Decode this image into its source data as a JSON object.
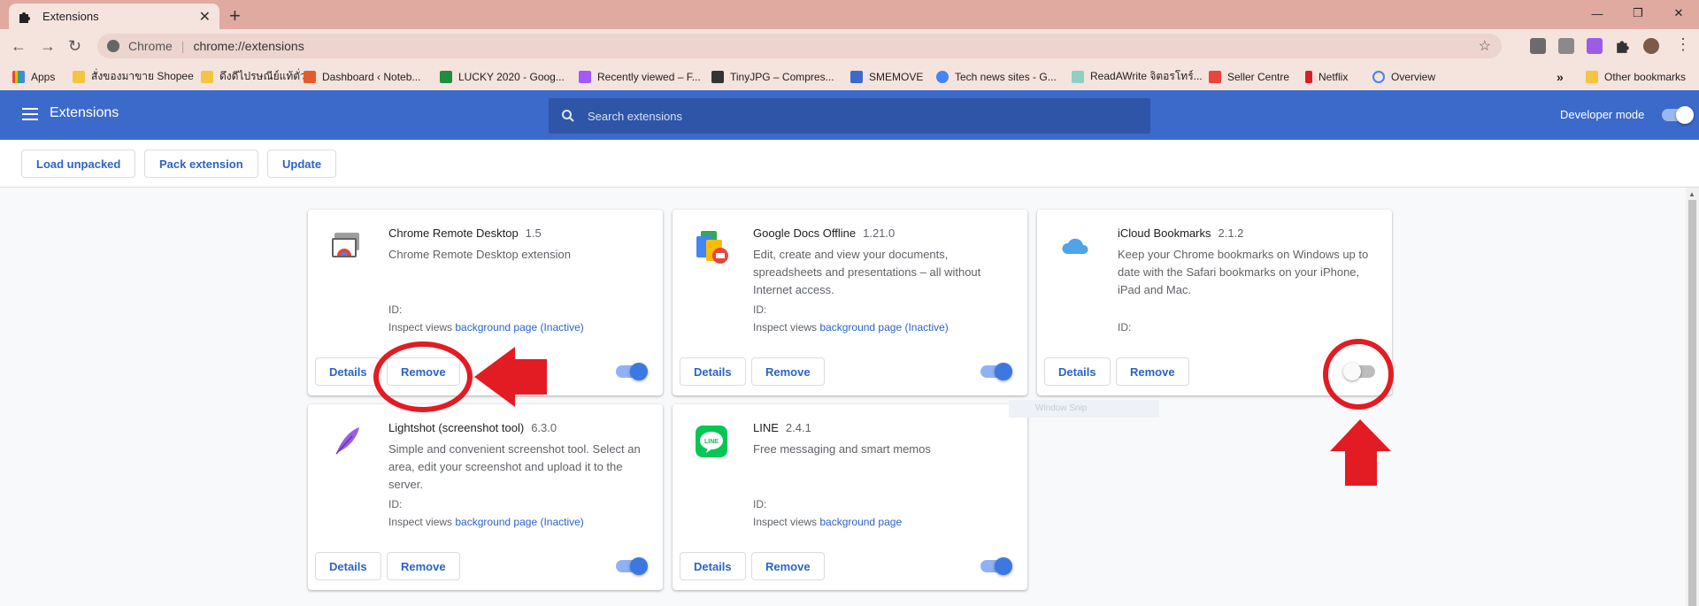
{
  "browser": {
    "tab_title": "Extensions",
    "omnibox_origin": "Chrome",
    "omnibox_url": "chrome://extensions"
  },
  "bookmarks": [
    {
      "label": "Apps",
      "color": "#e8453c"
    },
    {
      "label": "สั่งของมาขาย Shopee",
      "color": "#f4c542"
    },
    {
      "label": "ดึงดีไปรษณีย์แท้ตั่ว",
      "color": "#f4c542"
    },
    {
      "label": "Dashboard ‹ Noteb...",
      "color": "#e65c28"
    },
    {
      "label": "LUCKY 2020 - Goog...",
      "color": "#1e8e3e"
    },
    {
      "label": "Recently viewed – F...",
      "color": "#a259ff"
    },
    {
      "label": "TinyJPG – Compres...",
      "color": "#333333"
    },
    {
      "label": "SMEMOVE",
      "color": "#3c6acb"
    },
    {
      "label": "Tech news sites - G...",
      "color": "#4285f4"
    },
    {
      "label": "ReadAWrite จิตอรโทร์...",
      "color": "#8ed1c2"
    },
    {
      "label": "Seller Centre",
      "color": "#e8453c"
    },
    {
      "label": "Netflix",
      "color": "#d81f26"
    },
    {
      "label": "Overview",
      "color": "#4285f4"
    }
  ],
  "bookmarks_overflow": "»",
  "other_bookmarks": "Other bookmarks",
  "header": {
    "title": "Extensions",
    "search_placeholder": "Search extensions",
    "developer_mode_label": "Developer mode",
    "developer_mode_on": true
  },
  "devbar": {
    "load_unpacked": "Load unpacked",
    "pack_extension": "Pack extension",
    "update": "Update"
  },
  "labels": {
    "id": "ID:",
    "inspect_views": "Inspect views",
    "details": "Details",
    "remove": "Remove"
  },
  "extensions": [
    {
      "name": "Chrome Remote Desktop",
      "version": "1.5",
      "description": "Chrome Remote Desktop extension",
      "inspect_link": "background page (Inactive)",
      "enabled": true
    },
    {
      "name": "Google Docs Offline",
      "version": "1.21.0",
      "description": "Edit, create and view your documents, spreadsheets and presentations – all without Internet access.",
      "inspect_link": "background page (Inactive)",
      "enabled": true
    },
    {
      "name": "iCloud Bookmarks",
      "version": "2.1.2",
      "description": "Keep your Chrome bookmarks on Windows up to date with the Safari bookmarks on your iPhone, iPad and Mac.",
      "inspect_link": "",
      "enabled": false
    },
    {
      "name": "Lightshot (screenshot tool)",
      "version": "6.3.0",
      "description": "Simple and convenient screenshot tool. Select an area, edit your screenshot and upload it to the server.",
      "inspect_link": "background page (Inactive)",
      "enabled": true
    },
    {
      "name": "LINE",
      "version": "2.4.1",
      "description": "Free messaging and smart memos",
      "inspect_link": "background page",
      "enabled": true
    }
  ],
  "ghost_text": "Window Snip",
  "colors": {
    "header_blue": "#3c6acb",
    "accent_blue": "#2b63c8",
    "annotation_red": "#e31b23"
  }
}
